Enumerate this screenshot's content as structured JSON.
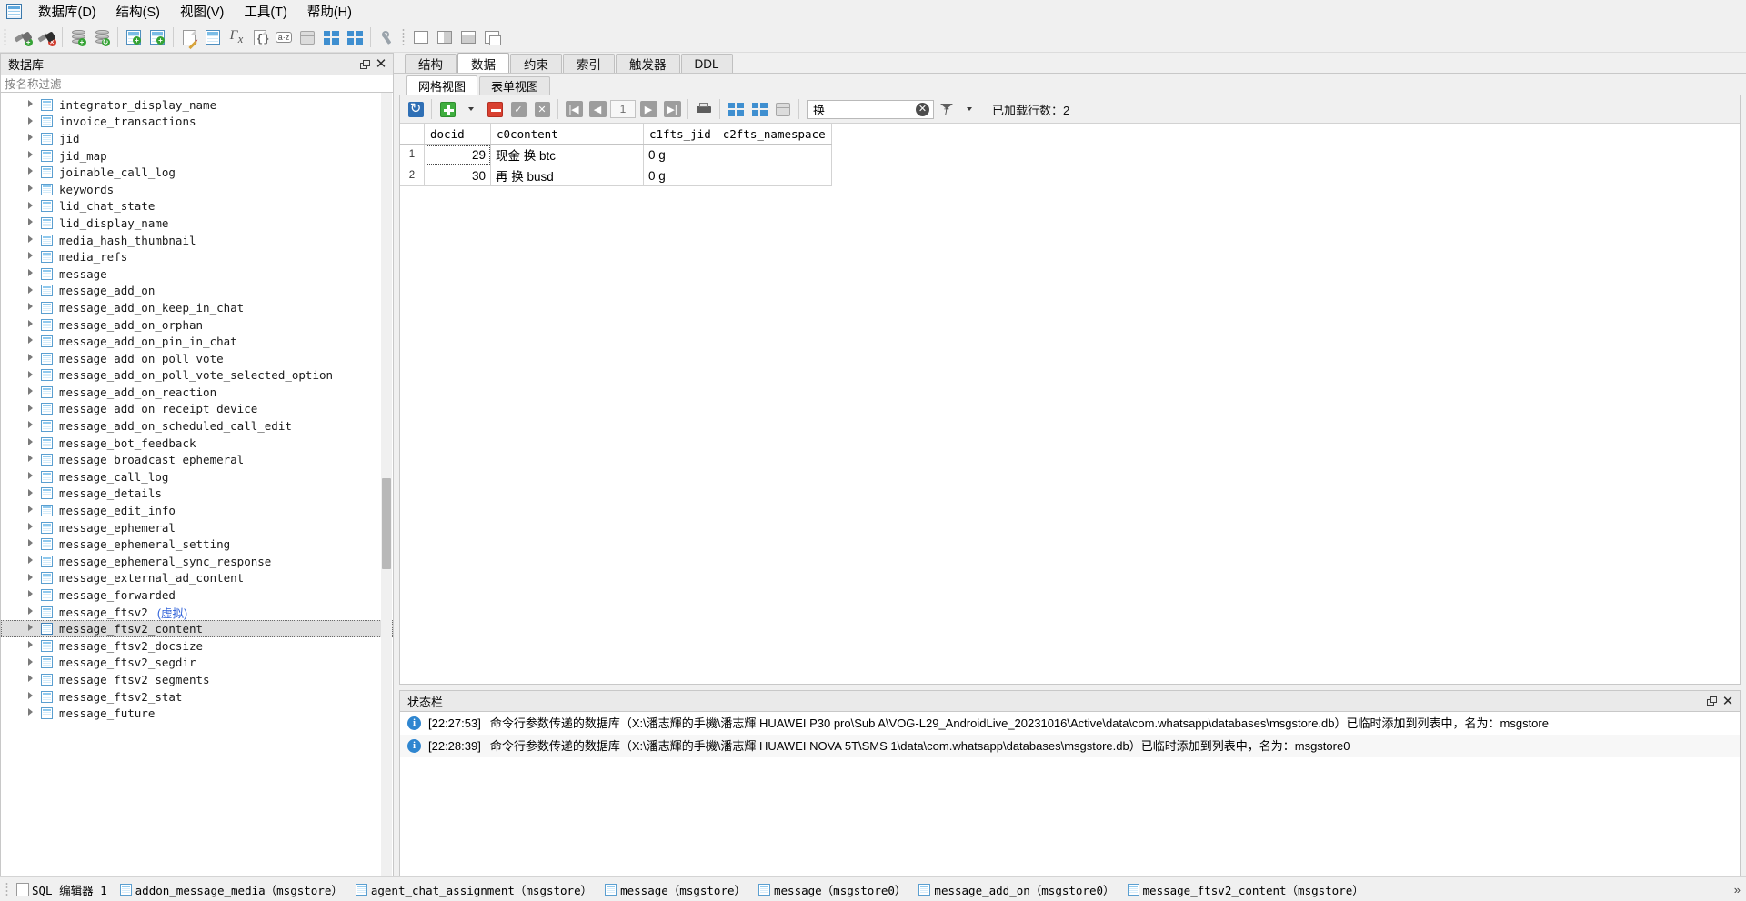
{
  "menubar": {
    "items": [
      {
        "label": "数据库(D)",
        "accel": "D"
      },
      {
        "label": "结构(S)",
        "accel": "S"
      },
      {
        "label": "视图(V)",
        "accel": "V"
      },
      {
        "label": "工具(T)",
        "accel": "T"
      },
      {
        "label": "帮助(H)",
        "accel": "H"
      }
    ]
  },
  "toolbar": {
    "buttons": [
      {
        "name": "connect-database-icon",
        "title": "连接数据库"
      },
      {
        "name": "disconnect-database-icon",
        "title": "断开数据库"
      },
      {
        "name": "add-database-icon",
        "title": "添加数据库"
      },
      {
        "name": "refresh-database-icon",
        "title": "刷新数据库"
      },
      {
        "name": "create-table-icon",
        "title": "创建表"
      },
      {
        "name": "create-index-icon",
        "title": "创建索引"
      },
      {
        "name": "create-view-icon",
        "title": "创建视图"
      },
      {
        "name": "create-trigger-icon",
        "title": "创建触发器"
      },
      {
        "name": "function-editor-icon",
        "title": "函数编辑器"
      },
      {
        "name": "code-snippet-icon",
        "title": "代码片段"
      },
      {
        "name": "collation-editor-icon",
        "title": "排序规则编辑器"
      },
      {
        "name": "extension-icon",
        "title": "扩展"
      },
      {
        "name": "import-icon",
        "title": "导入"
      },
      {
        "name": "export-icon",
        "title": "导出"
      },
      {
        "name": "settings-icon",
        "title": "设置"
      },
      {
        "name": "tile-windows-icon",
        "title": "平铺窗口"
      },
      {
        "name": "tile-vertical-icon",
        "title": "垂直平铺"
      },
      {
        "name": "tile-horizontal-icon",
        "title": "水平平铺"
      },
      {
        "name": "cascade-windows-icon",
        "title": "层叠窗口"
      }
    ]
  },
  "sidebar": {
    "title": "数据库",
    "filter_placeholder": "按名称过滤",
    "items": [
      {
        "label": "integrator_display_name",
        "virtual": ""
      },
      {
        "label": "invoice_transactions",
        "virtual": ""
      },
      {
        "label": "jid",
        "virtual": ""
      },
      {
        "label": "jid_map",
        "virtual": ""
      },
      {
        "label": "joinable_call_log",
        "virtual": ""
      },
      {
        "label": "keywords",
        "virtual": ""
      },
      {
        "label": "lid_chat_state",
        "virtual": ""
      },
      {
        "label": "lid_display_name",
        "virtual": ""
      },
      {
        "label": "media_hash_thumbnail",
        "virtual": ""
      },
      {
        "label": "media_refs",
        "virtual": ""
      },
      {
        "label": "message",
        "virtual": ""
      },
      {
        "label": "message_add_on",
        "virtual": ""
      },
      {
        "label": "message_add_on_keep_in_chat",
        "virtual": ""
      },
      {
        "label": "message_add_on_orphan",
        "virtual": ""
      },
      {
        "label": "message_add_on_pin_in_chat",
        "virtual": ""
      },
      {
        "label": "message_add_on_poll_vote",
        "virtual": ""
      },
      {
        "label": "message_add_on_poll_vote_selected_option",
        "virtual": ""
      },
      {
        "label": "message_add_on_reaction",
        "virtual": ""
      },
      {
        "label": "message_add_on_receipt_device",
        "virtual": ""
      },
      {
        "label": "message_add_on_scheduled_call_edit",
        "virtual": ""
      },
      {
        "label": "message_bot_feedback",
        "virtual": ""
      },
      {
        "label": "message_broadcast_ephemeral",
        "virtual": ""
      },
      {
        "label": "message_call_log",
        "virtual": ""
      },
      {
        "label": "message_details",
        "virtual": ""
      },
      {
        "label": "message_edit_info",
        "virtual": ""
      },
      {
        "label": "message_ephemeral",
        "virtual": ""
      },
      {
        "label": "message_ephemeral_setting",
        "virtual": ""
      },
      {
        "label": "message_ephemeral_sync_response",
        "virtual": ""
      },
      {
        "label": "message_external_ad_content",
        "virtual": ""
      },
      {
        "label": "message_forwarded",
        "virtual": ""
      },
      {
        "label": "message_ftsv2",
        "virtual": "(虚拟)"
      },
      {
        "label": "message_ftsv2_content",
        "virtual": "",
        "selected": true
      },
      {
        "label": "message_ftsv2_docsize",
        "virtual": ""
      },
      {
        "label": "message_ftsv2_segdir",
        "virtual": ""
      },
      {
        "label": "message_ftsv2_segments",
        "virtual": ""
      },
      {
        "label": "message_ftsv2_stat",
        "virtual": ""
      },
      {
        "label": "message_future",
        "virtual": ""
      }
    ]
  },
  "editor": {
    "tabs": [
      {
        "label": "结构",
        "active": false
      },
      {
        "label": "数据",
        "active": true
      },
      {
        "label": "约束",
        "active": false
      },
      {
        "label": "索引",
        "active": false
      },
      {
        "label": "触发器",
        "active": false
      },
      {
        "label": "DDL",
        "active": false
      }
    ],
    "subtabs": [
      {
        "label": "网格视图",
        "active": true
      },
      {
        "label": "表单视图",
        "active": false
      }
    ],
    "grid_toolbar": {
      "page_number": "1",
      "search_value": "换",
      "loaded_rows_label": "已加载行数：2",
      "buttons": [
        {
          "name": "refresh-data-icon",
          "title": "刷新数据"
        },
        {
          "name": "insert-row-icon",
          "title": "插入行"
        },
        {
          "name": "insert-row-dropdown-icon",
          "title": "插入选项"
        },
        {
          "name": "delete-row-icon",
          "title": "删除行"
        },
        {
          "name": "commit-icon",
          "title": "提交"
        },
        {
          "name": "rollback-icon",
          "title": "回滚"
        },
        {
          "name": "first-page-icon",
          "title": "首页"
        },
        {
          "name": "previous-page-icon",
          "title": "上一页"
        },
        {
          "name": "next-page-icon",
          "title": "下一页"
        },
        {
          "name": "last-page-icon",
          "title": "末页"
        },
        {
          "name": "print-icon",
          "title": "打印"
        },
        {
          "name": "import-data-icon",
          "title": "导入数据"
        },
        {
          "name": "export-data-icon",
          "title": "导出数据"
        },
        {
          "name": "populate-table-icon",
          "title": "填充表"
        },
        {
          "name": "clear-search-icon",
          "title": "清除"
        },
        {
          "name": "filter-mode-icon",
          "title": "筛选模式"
        },
        {
          "name": "filter-dropdown-icon",
          "title": "筛选下拉"
        }
      ]
    },
    "grid": {
      "columns": [
        "docid",
        "c0content",
        "c1fts_jid",
        "c2fts_namespace"
      ],
      "rows": [
        {
          "index": "1",
          "docid": "29",
          "c0content": "现金 换 btc",
          "c1fts_jid": "0 g",
          "c2fts_namespace": ""
        },
        {
          "index": "2",
          "docid": "30",
          "c0content": "再 换 busd",
          "c1fts_jid": "0 g",
          "c2fts_namespace": ""
        }
      ]
    }
  },
  "status_panel": {
    "title": "状态栏",
    "entries": [
      {
        "time": "[22:27:53]",
        "text": "命令行参数传递的数据库（X:\\潘志輝的手機\\潘志輝 HUAWEI P30 pro\\Sub A\\VOG-L29_AndroidLive_20231016\\Active\\data\\com.whatsapp\\databases\\msgstore.db）已临时添加到列表中，名为：msgstore"
      },
      {
        "time": "[22:28:39]",
        "text": "命令行参数传递的数据库（X:\\潘志輝的手機\\潘志輝 HUAWEI NOVA 5T\\SMS 1\\data\\com.whatsapp\\databases\\msgstore.db）已临时添加到列表中，名为：msgstore0"
      }
    ]
  },
  "bottom_tabs": [
    {
      "label": "SQL 编辑器 1",
      "icon": "sql-editor-icon"
    },
    {
      "label": "addon_message_media（msgstore）",
      "icon": "table-icon"
    },
    {
      "label": "agent_chat_assignment（msgstore）",
      "icon": "table-icon"
    },
    {
      "label": "message（msgstore）",
      "icon": "table-icon"
    },
    {
      "label": "message（msgstore0）",
      "icon": "table-icon"
    },
    {
      "label": "message_add_on（msgstore0）",
      "icon": "table-icon"
    },
    {
      "label": "message_ftsv2_content（msgstore）",
      "icon": "table-icon"
    }
  ],
  "colors": {
    "accent_blue": "#2f6fb5",
    "virtual_label": "#2c5fd8",
    "add_green": "#3fae3f",
    "delete_red": "#d94030"
  }
}
